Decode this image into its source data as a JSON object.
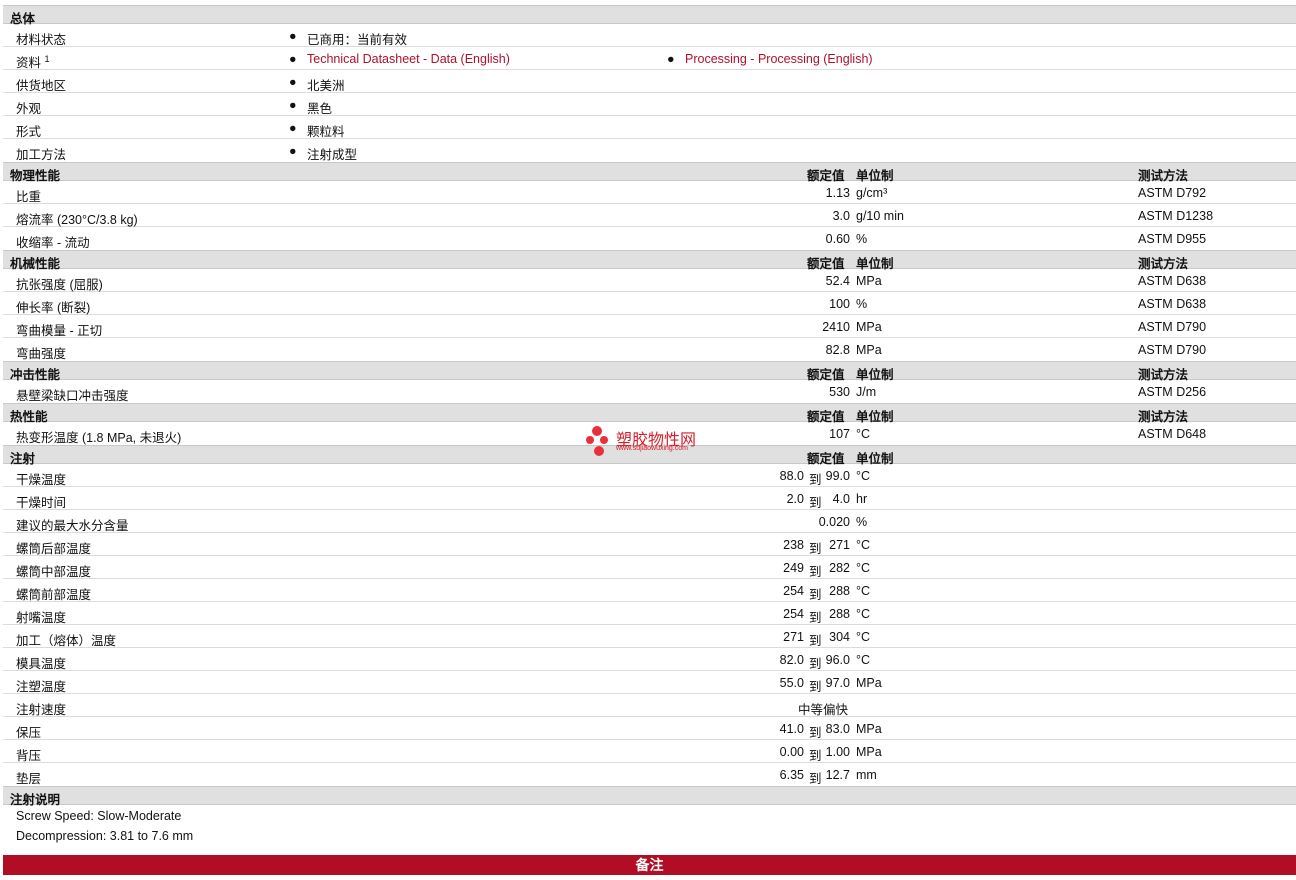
{
  "general": {
    "title": "总体",
    "rows": [
      {
        "label": "材料状态",
        "values": [
          "已商用：当前有效"
        ]
      },
      {
        "label": "资料",
        "sup": "1",
        "values": [
          "Technical Datasheet - Data (English)",
          "Processing - Processing (English)"
        ]
      },
      {
        "label": "供货地区",
        "values": [
          "北美洲"
        ]
      },
      {
        "label": "外观",
        "values": [
          "黑色"
        ]
      },
      {
        "label": "形式",
        "values": [
          "颗粒料"
        ]
      },
      {
        "label": "加工方法",
        "values": [
          "注射成型"
        ]
      }
    ]
  },
  "headers": {
    "nominal": "额定值",
    "unit": "单位制",
    "test": "测试方法"
  },
  "physical": {
    "title": "物理性能",
    "rows": [
      {
        "label": "比重",
        "value": "1.13",
        "unit": "g/cm³",
        "test": "ASTM D792"
      },
      {
        "label": "熔流率  (230°C/3.8 kg)",
        "value": "3.0",
        "unit": "g/10 min",
        "test": "ASTM D1238"
      },
      {
        "label": "收缩率  - 流动",
        "value": "0.60",
        "unit": "%",
        "test": "ASTM D955"
      }
    ]
  },
  "mechanical": {
    "title": "机械性能",
    "rows": [
      {
        "label": "抗张强度  (屈服)",
        "value": "52.4",
        "unit": "MPa",
        "test": "ASTM D638"
      },
      {
        "label": "伸长率  (断裂)",
        "value": "100",
        "unit": "%",
        "test": "ASTM D638"
      },
      {
        "label": "弯曲模量  - 正切",
        "value": "2410",
        "unit": "MPa",
        "test": "ASTM D790"
      },
      {
        "label": "弯曲强度",
        "value": "82.8",
        "unit": "MPa",
        "test": "ASTM D790"
      }
    ]
  },
  "impact": {
    "title": "冲击性能",
    "rows": [
      {
        "label": "悬壁梁缺口冲击强度",
        "value": "530",
        "unit": "J/m",
        "test": "ASTM D256"
      }
    ]
  },
  "thermal": {
    "title": "热性能",
    "rows": [
      {
        "label": "热变形温度  (1.8 MPa, 未退火)",
        "value": "107",
        "unit": "°C",
        "test": "ASTM D648"
      }
    ]
  },
  "injection": {
    "title": "注射",
    "to": "到",
    "rows": [
      {
        "label": "干燥温度",
        "a": "88.0",
        "b": "99.0",
        "unit": "°C"
      },
      {
        "label": "干燥时间",
        "a": "2.0",
        "b": "4.0",
        "unit": "hr"
      },
      {
        "label": "建议的最大水分含量",
        "value": "0.020",
        "unit": "%"
      },
      {
        "label": "螺筒后部温度",
        "a": "238",
        "b": "271",
        "unit": "°C"
      },
      {
        "label": "螺筒中部温度",
        "a": "249",
        "b": "282",
        "unit": "°C"
      },
      {
        "label": "螺筒前部温度",
        "a": "254",
        "b": "288",
        "unit": "°C"
      },
      {
        "label": "射嘴温度",
        "a": "254",
        "b": "288",
        "unit": "°C"
      },
      {
        "label": "加工（熔体）温度",
        "a": "271",
        "b": "304",
        "unit": "°C"
      },
      {
        "label": "模具温度",
        "a": "82.0",
        "b": "96.0",
        "unit": "°C"
      },
      {
        "label": "注塑温度",
        "a": "55.0",
        "b": "97.0",
        "unit": "MPa"
      },
      {
        "label": "注射速度",
        "text": "中等偏快"
      },
      {
        "label": "保压",
        "a": "41.0",
        "b": "83.0",
        "unit": "MPa"
      },
      {
        "label": "背压",
        "a": "0.00",
        "b": "1.00",
        "unit": "MPa"
      },
      {
        "label": "垫层",
        "a": "6.35",
        "b": "12.7",
        "unit": "mm"
      }
    ]
  },
  "injection_notes": {
    "title": "注射说明",
    "lines": [
      "Screw Speed: Slow-Moderate",
      "Decompression: 3.81 to 7.6 mm"
    ]
  },
  "footer": {
    "title": "备注"
  },
  "watermark": {
    "text": "塑胶物性网",
    "url": "www.sujiaowuxing.com"
  },
  "colors": {
    "accent": "#b10d24",
    "link": "#b0102a",
    "section_bg": "#e0e0e0"
  }
}
